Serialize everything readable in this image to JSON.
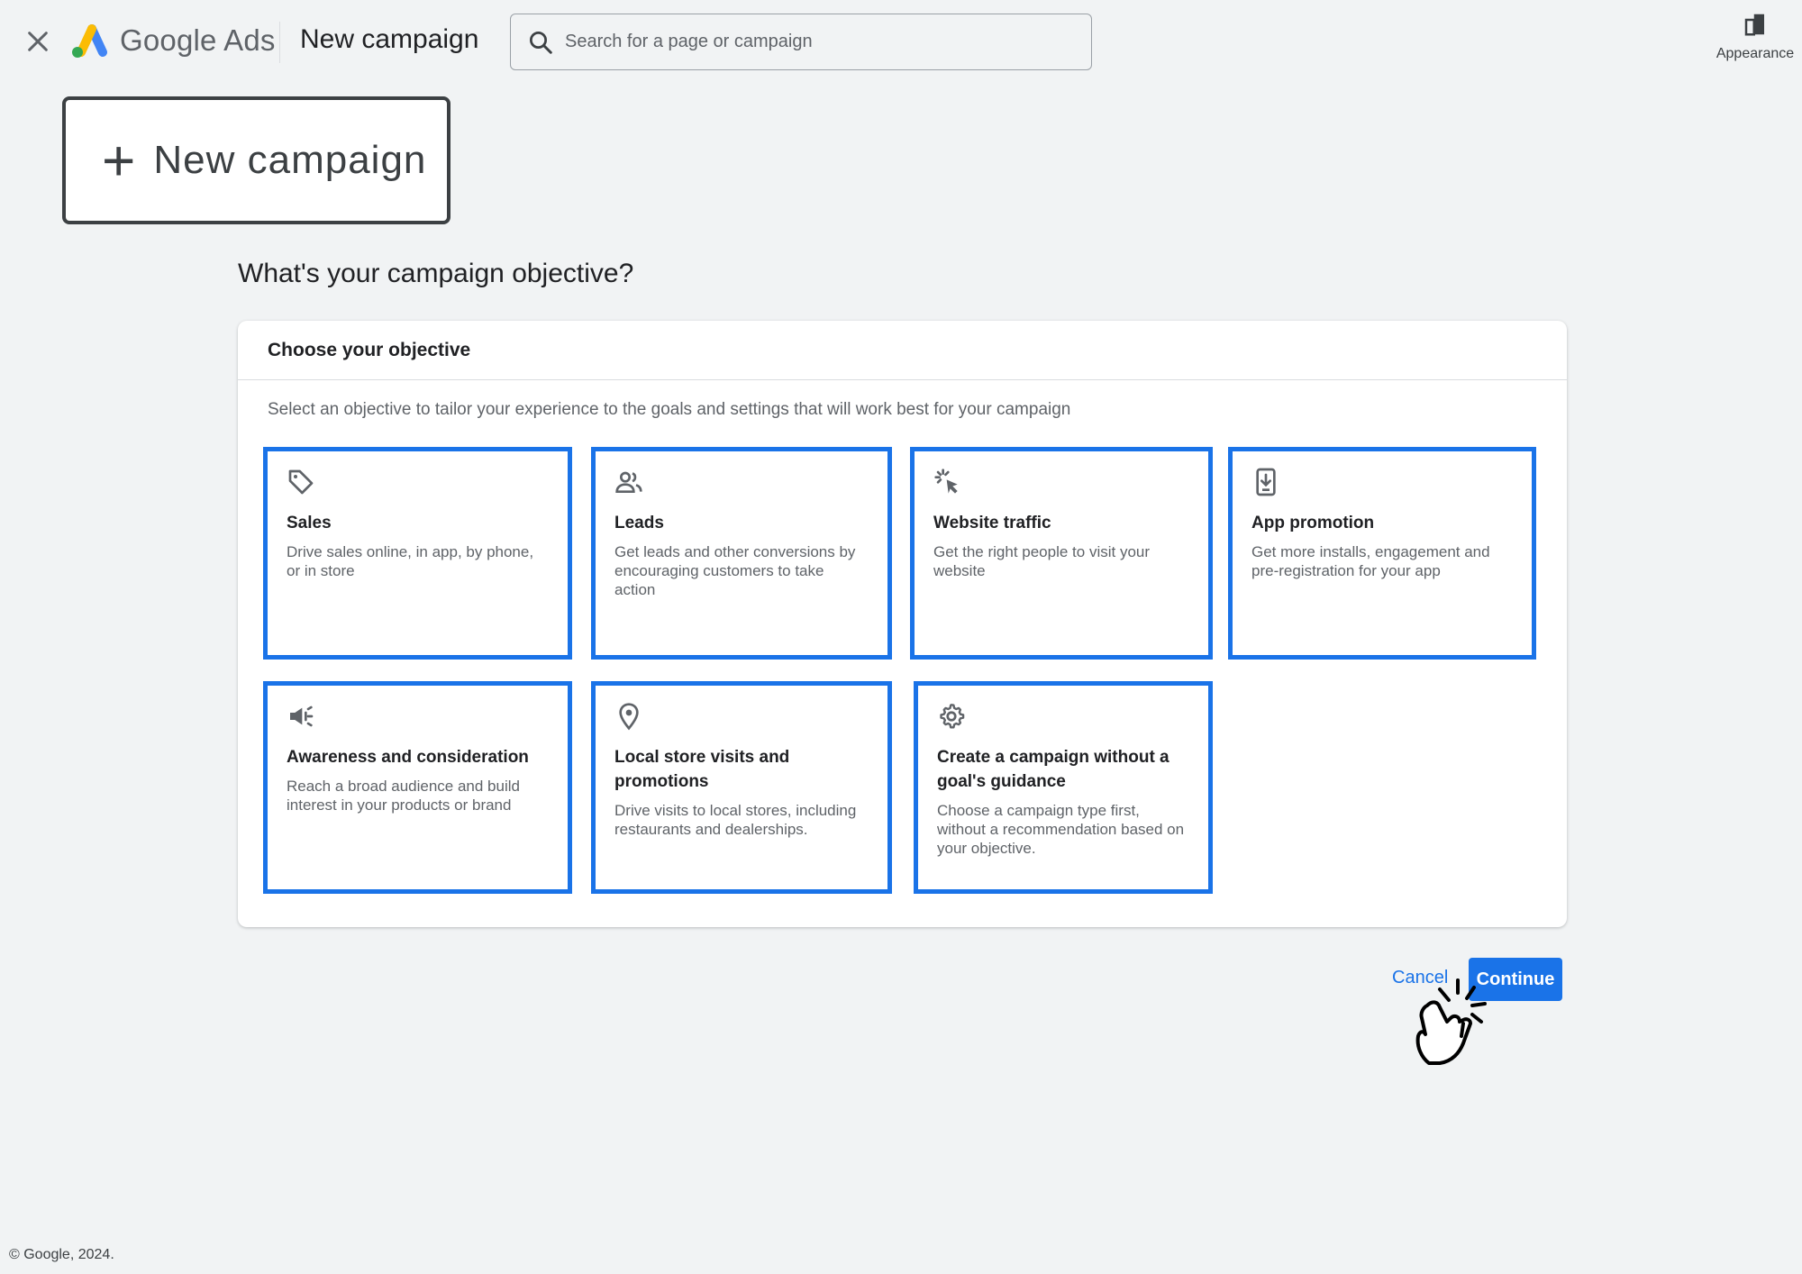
{
  "header": {
    "brand": "Google Ads",
    "page_name": "New campaign",
    "search_placeholder": "Search for a page or campaign",
    "appearance_label": "Appearance"
  },
  "new_campaign_button": {
    "label": "New campaign"
  },
  "question": "What's your campaign objective?",
  "objective_card": {
    "title": "Choose your objective",
    "description": "Select an objective to tailor your experience to the goals and settings that will work best for your campaign",
    "objectives": [
      {
        "icon": "tag-icon",
        "title": "Sales",
        "description": "Drive sales online, in app, by phone, or in store"
      },
      {
        "icon": "people-icon",
        "title": "Leads",
        "description": "Get leads and other conversions by encouraging customers to take action"
      },
      {
        "icon": "cursor-click-icon",
        "title": "Website traffic",
        "description": "Get the right people to visit your website"
      },
      {
        "icon": "phone-download-icon",
        "title": "App promotion",
        "description": "Get more installs, engagement and pre-registration for your app"
      },
      {
        "icon": "megaphone-icon",
        "title": "Awareness and consideration",
        "description": "Reach a broad audience and build interest in your products or brand"
      },
      {
        "icon": "location-pin-icon",
        "title": "Local store visits and promotions",
        "description": "Drive visits to local stores, including restaurants and dealerships."
      },
      {
        "icon": "gear-icon",
        "title": "Create a campaign without a goal's guidance",
        "description": "Choose a campaign type first, without a recommendation based on your objective."
      }
    ]
  },
  "actions": {
    "cancel": "Cancel",
    "continue": "Continue"
  },
  "footer": "© Google, 2024.",
  "colors": {
    "accent": "#1a73e8",
    "background": "#f1f3f4",
    "logo_blue": "#4285f4",
    "logo_yellow": "#fbbc04",
    "logo_green": "#34a853"
  }
}
